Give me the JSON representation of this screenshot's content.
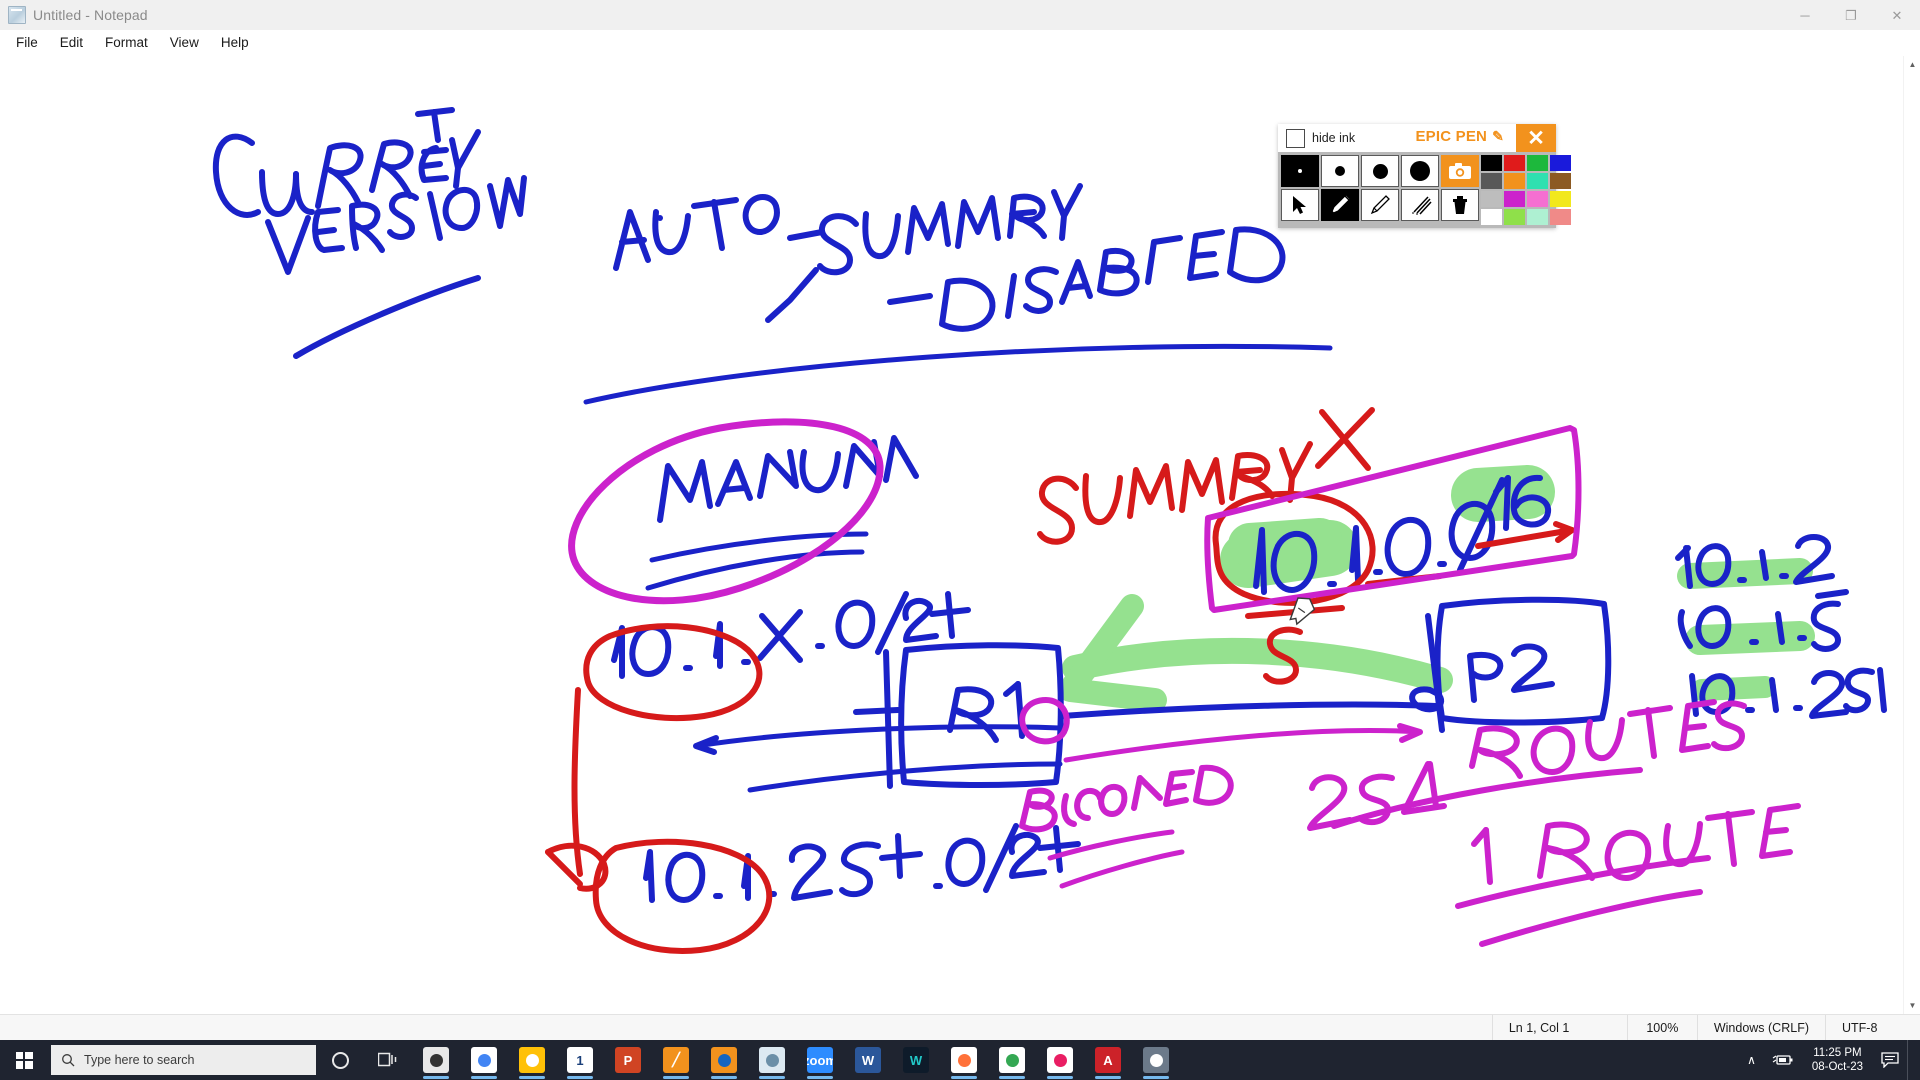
{
  "window": {
    "title": "Untitled - Notepad",
    "app_icon": "notepad-icon",
    "controls": {
      "minimize": "─",
      "maximize": "❐",
      "close": "✕"
    },
    "menu": [
      "File",
      "Edit",
      "Format",
      "View",
      "Help"
    ]
  },
  "statusbar": {
    "cursor": "Ln 1, Col 1",
    "zoom": "100%",
    "line_ending": "Windows (CRLF)",
    "encoding": "UTF-8"
  },
  "epicpen": {
    "hide_ink_label": "hide ink",
    "brand": "EPIC PEN",
    "brand_icon": "pencil-icon",
    "close_label": "✕",
    "tools_row1": [
      {
        "name": "pen-size-xs",
        "icon": "dot-tiny"
      },
      {
        "name": "pen-size-s",
        "icon": "dot-small"
      },
      {
        "name": "pen-size-m",
        "icon": "dot-medium"
      },
      {
        "name": "pen-size-l",
        "icon": "dot-large"
      },
      {
        "name": "screenshot",
        "icon": "camera-icon"
      }
    ],
    "tools_row2": [
      {
        "name": "cursor-tool",
        "icon": "arrow-cursor-icon"
      },
      {
        "name": "pen-tool",
        "icon": "pencil-icon"
      },
      {
        "name": "highlighter-tool",
        "icon": "pen-icon"
      },
      {
        "name": "eraser-tool",
        "icon": "eraser-icon"
      },
      {
        "name": "clear-all",
        "icon": "trash-icon"
      }
    ],
    "colors": [
      "#000000",
      "#E01B1B",
      "#1DB83C",
      "#1A1ADB",
      "#585858",
      "#F2921D",
      "#2FE0B0",
      "#8C5A22",
      "#BDBDBD",
      "#CC22CC",
      "#F56FD1",
      "#F2E81D",
      "#FFFFFF",
      "#8FE04A",
      "#AEF0D2",
      "#F08A88"
    ],
    "current_color": "#E01B1B"
  },
  "taskbar": {
    "start": "windows-logo",
    "search_placeholder": "Type here to search",
    "cortana": "cortana-circle-icon",
    "taskview": "task-view-icon",
    "apps": [
      {
        "name": "snipping-tool",
        "label": "",
        "bg": "#e8e8e8",
        "fg": "#333333",
        "running": true
      },
      {
        "name": "google-chrome",
        "label": "",
        "bg": "#ffffff",
        "fg": "#4285F4",
        "running": true
      },
      {
        "name": "file-explorer",
        "label": "",
        "bg": "#FFC107",
        "fg": "#ffffff",
        "running": true
      },
      {
        "name": "onenote",
        "label": "1",
        "bg": "#ffffff",
        "fg": "#1a3f7a",
        "running": true
      },
      {
        "name": "powerpoint",
        "label": "P",
        "bg": "#D04423",
        "fg": "#ffffff",
        "running": false
      },
      {
        "name": "epic-pen",
        "label": "╱",
        "bg": "#F2921D",
        "fg": "#ffffff",
        "running": true
      },
      {
        "name": "obs-studio",
        "label": "",
        "bg": "#F2921D",
        "fg": "#1565C0",
        "running": true
      },
      {
        "name": "notepad",
        "label": "",
        "bg": "#dce9f2",
        "fg": "#6b8fa8",
        "running": true
      },
      {
        "name": "zoom",
        "label": "zoom",
        "bg": "#2D8CFF",
        "fg": "#ffffff",
        "running": true
      },
      {
        "name": "microsoft-word",
        "label": "W",
        "bg": "#2B579A",
        "fg": "#ffffff",
        "running": false
      },
      {
        "name": "wondershare",
        "label": "W",
        "bg": "#0E1B2A",
        "fg": "#22C8C8",
        "running": false
      },
      {
        "name": "mozilla-firefox",
        "label": "",
        "bg": "#ffffff",
        "fg": "#FF7139",
        "running": true
      },
      {
        "name": "chrome-secondary",
        "label": "",
        "bg": "#ffffff",
        "fg": "#34A853",
        "running": true
      },
      {
        "name": "paint",
        "label": "",
        "bg": "#ffffff",
        "fg": "#E91E63",
        "running": true
      },
      {
        "name": "adobe-acrobat",
        "label": "A",
        "bg": "#CC2229",
        "fg": "#ffffff",
        "running": true
      },
      {
        "name": "calculator",
        "label": "",
        "bg": "#6c7a8a",
        "fg": "#ffffff",
        "running": true
      }
    ],
    "tray": {
      "chevron": "∧",
      "battery": "battery-charging-icon",
      "time": "11:25 PM",
      "date": "08-Oct-23",
      "action_center": "notifications-icon"
    }
  },
  "annotations": {
    "blue": {
      "heading_line1": "CURRENT",
      "heading_line2": "VERSION",
      "auto_summary": "AUTO-",
      "summary_word": "SUMMARY",
      "disabled": "-DISABLED",
      "check": "✓",
      "manual": "MANUAL",
      "subnet_variable": "10.1.X.0/24",
      "subnet_254": "10.1.254.0/24",
      "summary_route": "10.1.0.0/16",
      "router1": "R1",
      "router2": "R2",
      "host1": "10.1.2",
      "host2": "10.1.5",
      "host3": "10.1.251"
    },
    "red": {
      "summary_label": "SUMMARY",
      "cross": "X",
      "s_letter": "S"
    },
    "magenta": {
      "blocked": "BLOCKED",
      "routes_254": "254  ROUTES",
      "route_1": "1  ROUTE"
    },
    "colors": {
      "blue": "#1A22C8",
      "red": "#D61A1A",
      "magenta": "#CC22CC",
      "green_highlight": "#90E08A"
    }
  }
}
